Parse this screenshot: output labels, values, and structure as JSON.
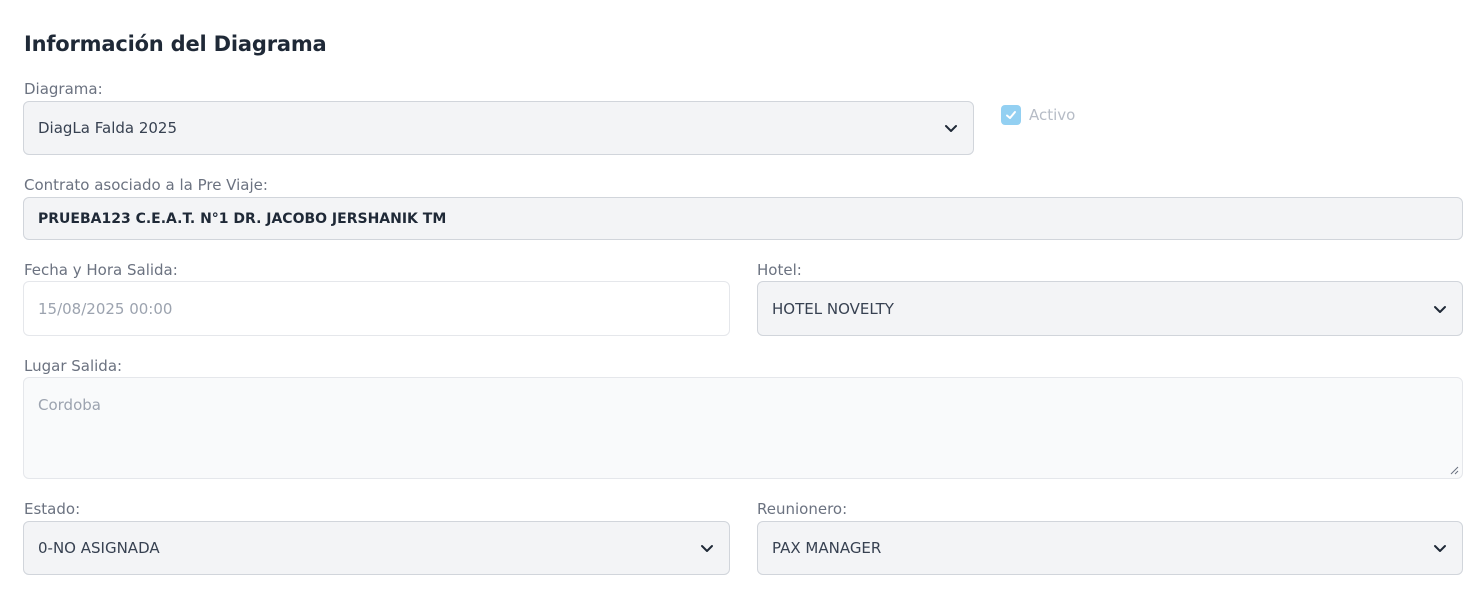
{
  "section": {
    "title": "Información del Diagrama"
  },
  "diagrama": {
    "label": "Diagrama:",
    "value": "DiagLa Falda 2025"
  },
  "activo": {
    "label": "Activo",
    "checked": true
  },
  "contrato": {
    "label": "Contrato asociado a la Pre Viaje:",
    "value": "PRUEBA123 C.E.A.T. N°1 DR. JACOBO JERSHANIK TM"
  },
  "fecha": {
    "label": "Fecha y Hora Salida:",
    "value": "15/08/2025 00:00"
  },
  "hotel": {
    "label": "Hotel:",
    "value": "HOTEL NOVELTY"
  },
  "lugar": {
    "label": "Lugar Salida:",
    "value": "Cordoba"
  },
  "estado": {
    "label": "Estado:",
    "value": "0-NO ASIGNADA"
  },
  "reunionero": {
    "label": "Reunionero:",
    "value": "PAX MANAGER"
  },
  "icons": {
    "chevron": "chevron-down-icon",
    "check": "check-icon",
    "resize": "resize-handle-icon"
  },
  "colors": {
    "checkbox": "#93d0f2",
    "field_bg": "#f3f4f6",
    "border": "#d1d5db"
  }
}
